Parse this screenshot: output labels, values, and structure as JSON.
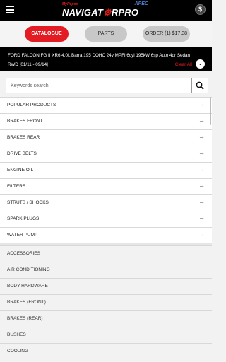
{
  "header": {
    "brand_small": "MyRepco",
    "brand_main_1": "NAVIGAT",
    "brand_main_2": "R",
    "brand_main_3": "PRO",
    "brand_apec": "APEC",
    "menu_icon": "hamburger-menu-icon",
    "account_icon": "dollar-account-icon",
    "account_symbol": "$"
  },
  "nav": {
    "catalogue": "CATALOGUE",
    "parts": "PARTS",
    "order": "ORDER (1) $17.38"
  },
  "vehicle": {
    "line1": "FORD FALCON FG II XR6 4.0L Barra 195 DOHC 24v MPFI 6cyl 195kW 6sp Auto 4dr Sedan",
    "line2": "RWD [01/11 - 09/14]",
    "clear_all": "Clear All",
    "clear_icon": "chevron-down-icon",
    "clear_symbol": "⌄"
  },
  "search": {
    "placeholder": "Keywords search",
    "value": "",
    "icon": "search-icon"
  },
  "popular_categories": [
    "POPULAR PRODUCTS",
    "BRAKES FRONT",
    "BRAKES REAR",
    "DRIVE BELTS",
    "ENGINE OIL",
    "FILTERS",
    "STRUTS / SHOCKS",
    "SPARK PLUGS",
    "WATER PUMP"
  ],
  "arrow_symbol": "→",
  "all_categories": [
    "ACCESSORIES",
    "AIR CONDITIONING",
    "BODY HARDWARE",
    "BRAKES (FRONT)",
    "BRAKES (REAR)",
    "BUSHES",
    "COOLING"
  ],
  "colors": {
    "accent": "#e31b23",
    "header_bg": "#000000",
    "pill_inactive": "#c8c8c8"
  }
}
